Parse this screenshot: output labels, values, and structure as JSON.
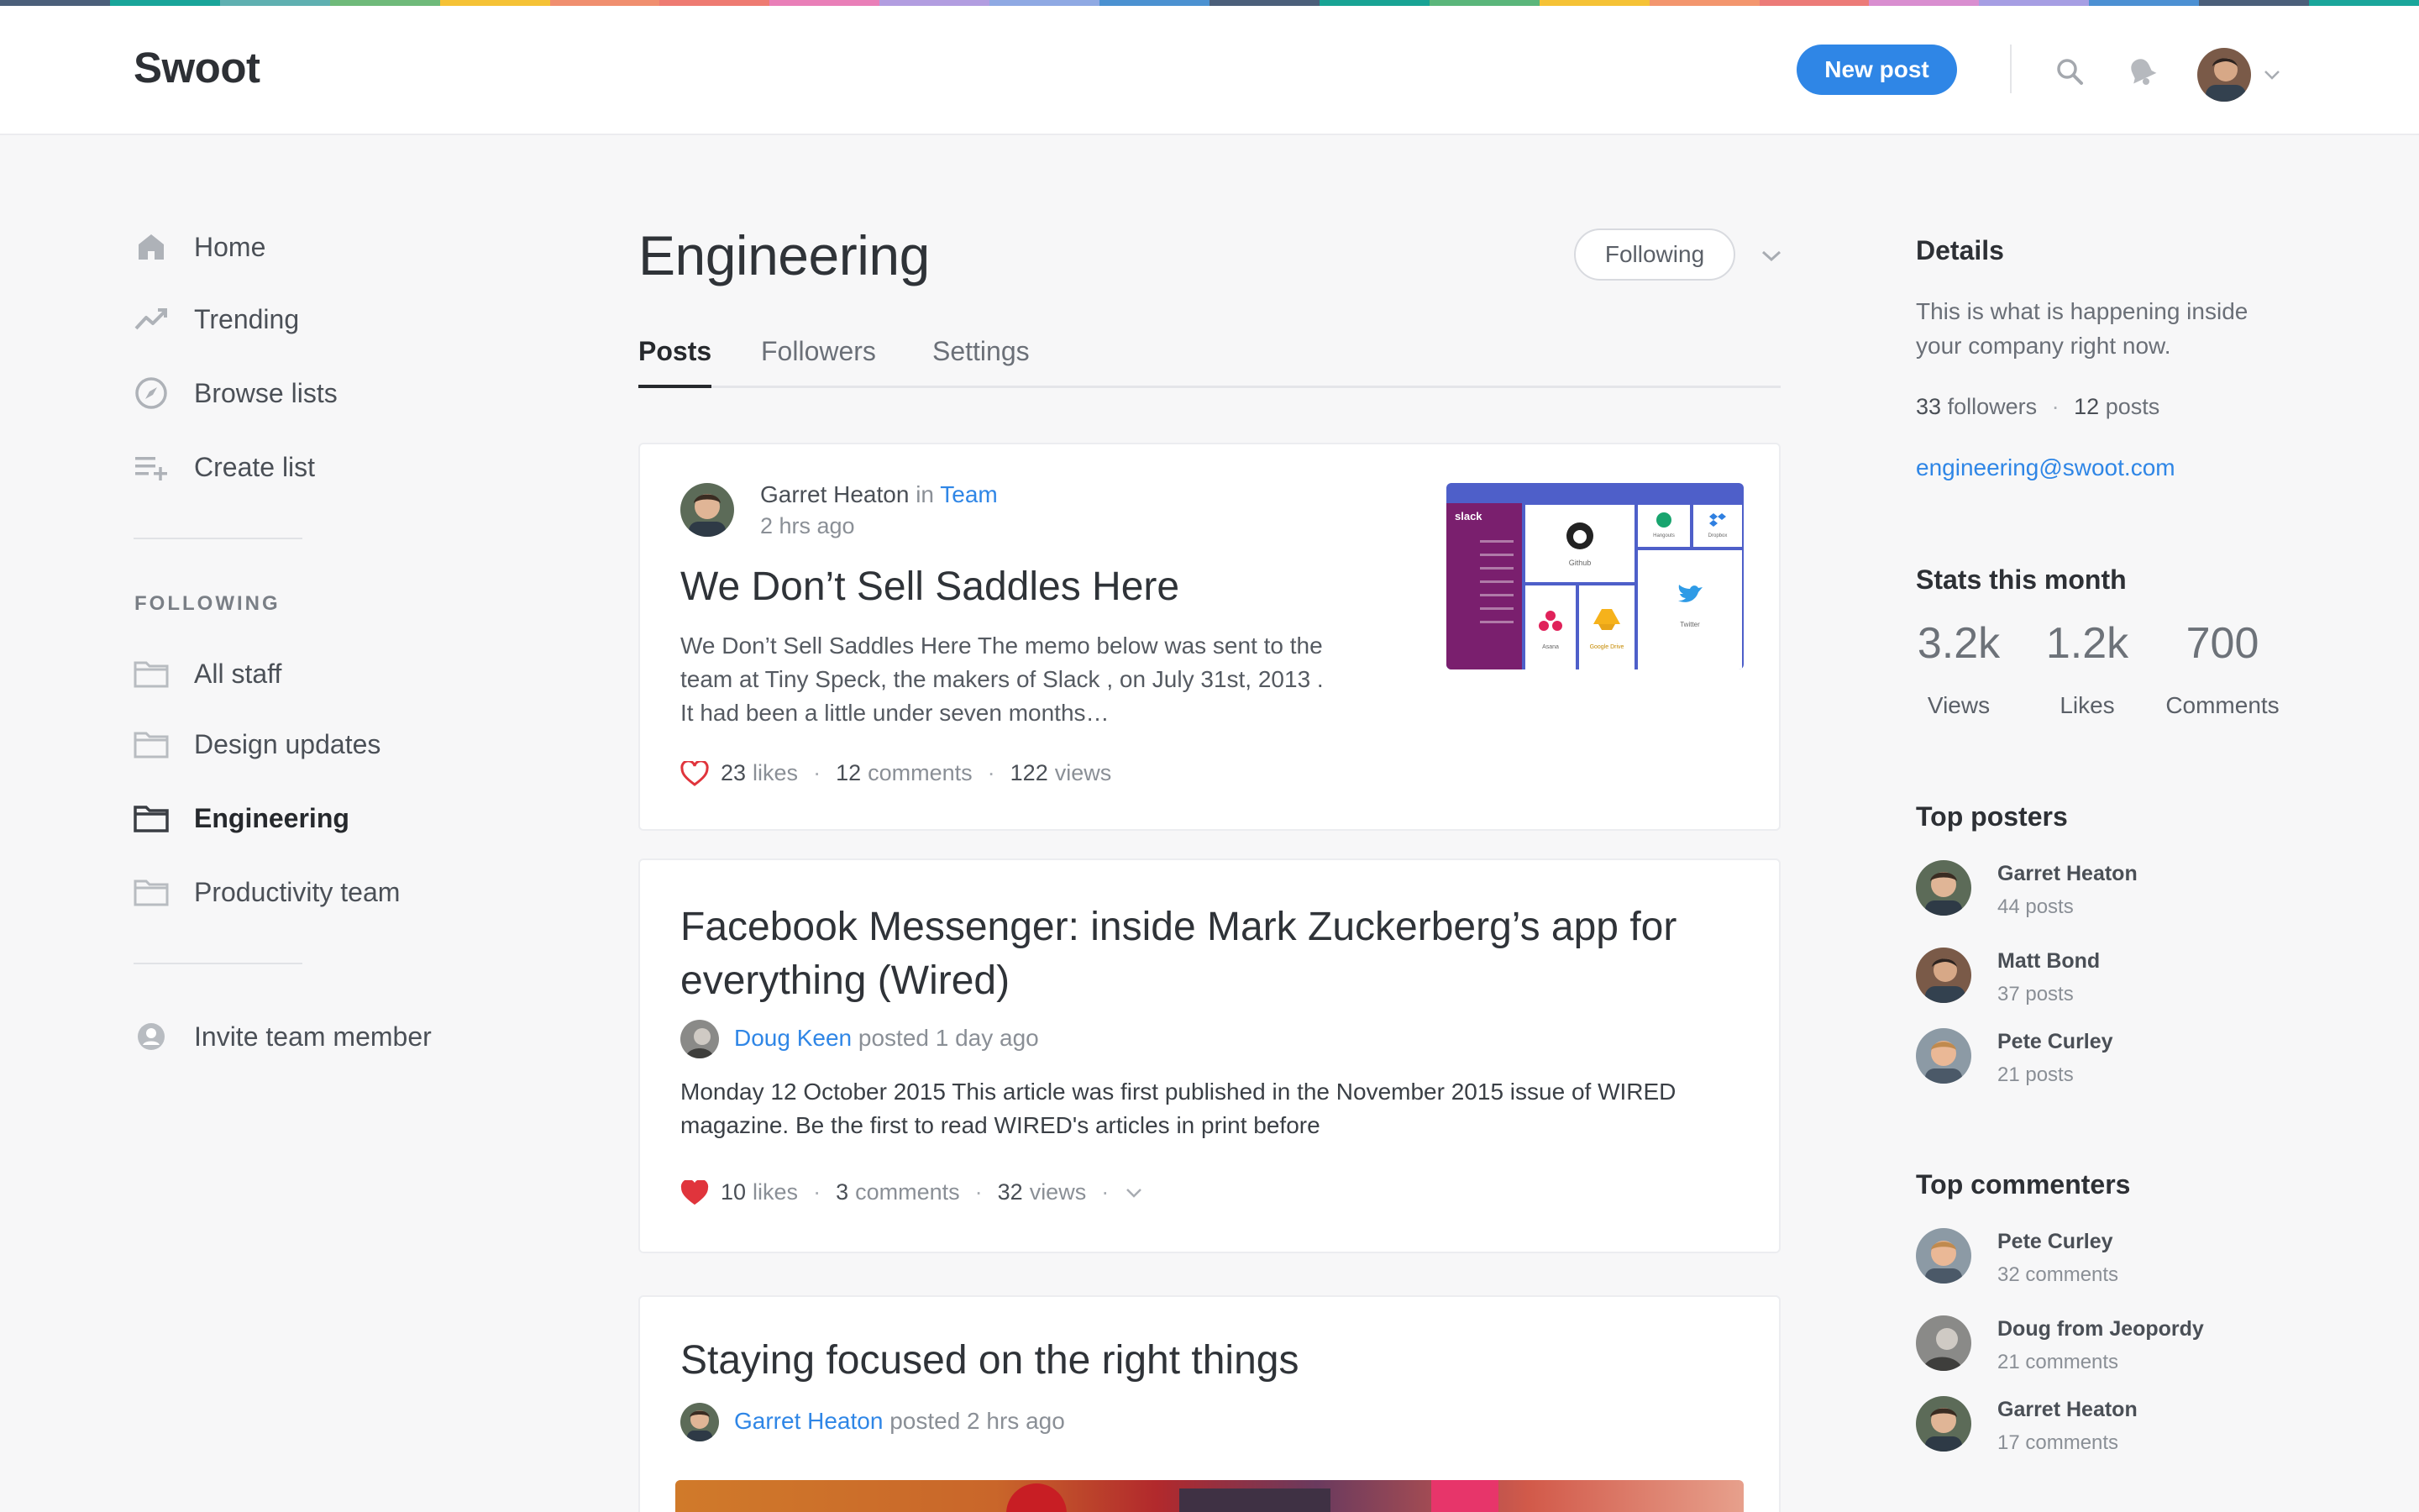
{
  "colors": {
    "accent": "#2f86e6",
    "heart": "#e0343c",
    "strip": [
      "#4b5f7a",
      "#19a59a",
      "#5fb0b1",
      "#6fba7a",
      "#f5c236",
      "#f08f6f",
      "#ee7b72",
      "#e97fb8",
      "#b29de0",
      "#8fa9e3",
      "#4b91d1",
      "#4b5f7a",
      "#18a394",
      "#5bb67b",
      "#f5c236",
      "#f3966e",
      "#ec7b78",
      "#d98ed0",
      "#a69ee3",
      "#4c90d3",
      "#4b5f7a",
      "#1aa69b"
    ]
  },
  "header": {
    "logo": "Swoot",
    "new_post_label": "New post",
    "search_icon": "search-icon",
    "notifications_icon": "bell-icon"
  },
  "nav": {
    "items": [
      {
        "label": "Home",
        "icon": "home-icon"
      },
      {
        "label": "Trending",
        "icon": "trending-icon"
      },
      {
        "label": "Browse lists",
        "icon": "compass-icon"
      },
      {
        "label": "Create list",
        "icon": "list-add-icon"
      }
    ],
    "following_heading": "FOLLOWING",
    "following": [
      {
        "label": "All staff",
        "icon": "folder-icon"
      },
      {
        "label": "Design updates",
        "icon": "folder-icon"
      },
      {
        "label": "Engineering",
        "icon": "folder-icon",
        "active": true
      },
      {
        "label": "Productivity team",
        "icon": "folder-icon"
      }
    ],
    "invite_label": "Invite team member"
  },
  "main": {
    "title": "Engineering",
    "following_label": "Following",
    "tabs": [
      {
        "label": "Posts",
        "active": true
      },
      {
        "label": "Followers"
      },
      {
        "label": "Settings"
      }
    ],
    "posts": [
      {
        "author": "Garret Heaton",
        "in_word": "in",
        "group": "Team",
        "time": "2 hrs ago",
        "title": "We Don’t Sell Saddles Here",
        "excerpt": "We Don’t Sell Saddles Here The memo below was sent to the team at Tiny Speck, the makers of Slack , on July 31st, 2013 . It had been a little under seven months…",
        "likes_n": "23",
        "likes_w": "likes",
        "comments_n": "12",
        "comments_w": "comments",
        "views_n": "122",
        "views_w": "views",
        "thumb": {
          "brand": "slack",
          "apps": [
            "Github",
            "Hangouts",
            "Dropbox",
            "Asana",
            "Google Drive",
            "Twitter"
          ]
        }
      },
      {
        "title": "Facebook Messenger: inside Mark Zuckerberg’s app for everything (Wired)",
        "author": "Doug Keen",
        "posted": "posted 1 day ago",
        "excerpt": "Monday 12 October 2015 This article was first published in the November 2015 issue of WIRED magazine. Be the first to read WIRED's articles in print before",
        "likes_n": "10",
        "likes_w": "likes",
        "comments_n": "3",
        "comments_w": "comments",
        "views_n": "32",
        "views_w": "views"
      },
      {
        "title": "Staying focused on the right things",
        "author": "Garret Heaton",
        "posted": "posted 2 hrs ago"
      }
    ]
  },
  "side": {
    "details_h": "Details",
    "details_text": "This is what is happening inside your company right now.",
    "followers_n": "33",
    "followers_w": "followers",
    "posts_n": "12",
    "posts_w": "posts",
    "email": "engineering@swoot.com",
    "stats_h": "Stats this month",
    "stats": [
      {
        "value": "3.2k",
        "label": "Views"
      },
      {
        "value": "1.2k",
        "label": "Likes"
      },
      {
        "value": "700",
        "label": "Comments"
      }
    ],
    "top_posters_h": "Top posters",
    "top_posters": [
      {
        "name": "Garret Heaton",
        "count": "44 posts"
      },
      {
        "name": "Matt Bond",
        "count": "37 posts"
      },
      {
        "name": "Pete Curley",
        "count": "21 posts"
      }
    ],
    "top_commenters_h": "Top commenters",
    "top_commenters": [
      {
        "name": "Pete Curley",
        "count": "32 comments"
      },
      {
        "name": "Doug from Jeopordy",
        "count": "21 comments"
      },
      {
        "name": "Garret Heaton",
        "count": "17 comments"
      }
    ]
  }
}
